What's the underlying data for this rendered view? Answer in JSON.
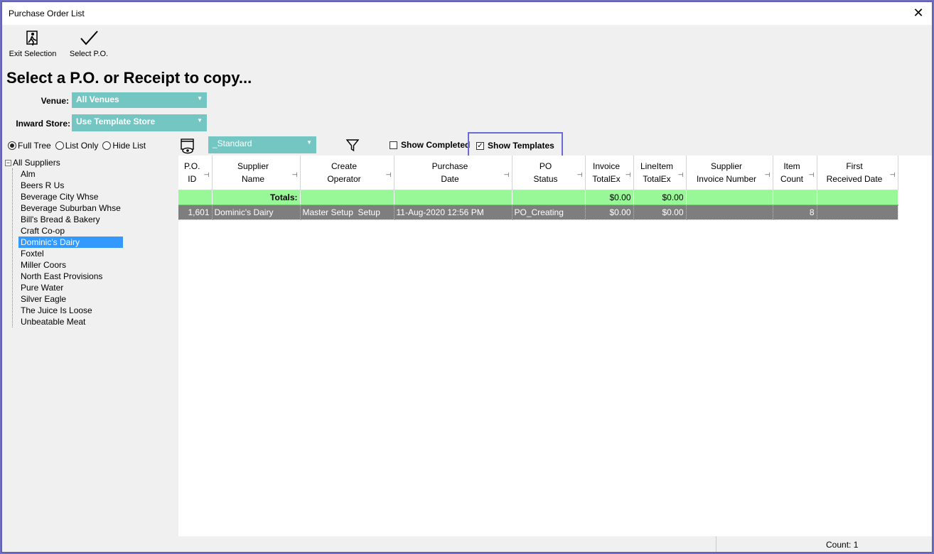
{
  "window": {
    "title": "Purchase Order List",
    "close_glyph": "✕"
  },
  "toolbar": {
    "exit_label": "Exit Selection",
    "select_label": "Select P.O."
  },
  "heading": "Select a P.O. or Receipt to copy...",
  "venue": {
    "label": "Venue:",
    "value": "All Venues"
  },
  "inward_store": {
    "label": "Inward Store:",
    "value": "Use Template Store"
  },
  "tree_mode": {
    "options": [
      "Full Tree",
      "List Only",
      "Hide List"
    ],
    "selected": "Full Tree"
  },
  "layout_combo": {
    "value": "_Standard"
  },
  "show_completed": {
    "label": "Show Completed",
    "checked": false
  },
  "show_templates": {
    "label": "Show Templates",
    "checked": true,
    "check_glyph": "✓"
  },
  "tree": {
    "root": "All Suppliers",
    "items": [
      "Alm",
      "Beers R Us",
      "Beverage City Whse",
      "Beverage Suburban Whse",
      "Bill's Bread & Bakery",
      "Craft Co-op",
      "Dominic's Dairy",
      "Foxtel",
      "Miller Coors",
      "North East Provisions",
      "Pure Water",
      "Silver Eagle",
      "The Juice Is Loose",
      "Unbeatable Meat"
    ],
    "selected": "Dominic's Dairy"
  },
  "grid": {
    "columns": [
      [
        "P.O.",
        "ID"
      ],
      [
        "Supplier",
        "Name"
      ],
      [
        "Create",
        "Operator"
      ],
      [
        "Purchase",
        "Date"
      ],
      [
        "PO",
        "Status"
      ],
      [
        "Invoice",
        "TotalEx"
      ],
      [
        "LineItem",
        "TotalEx"
      ],
      [
        "Supplier",
        "Invoice Number"
      ],
      [
        "Item",
        "Count"
      ],
      [
        "First",
        "Received Date"
      ]
    ],
    "totals_label": "Totals:",
    "totals": {
      "invoice_totalex": "$0.00",
      "lineitem_totalex": "$0.00"
    },
    "rows": [
      {
        "po_id": "1,601",
        "supplier": "Dominic's Dairy",
        "operator": "Master Setup  Setup",
        "date": "11-Aug-2020 12:56 PM",
        "status": "PO_Creating",
        "invoice_totalex": "$0.00",
        "lineitem_totalex": "$0.00",
        "invoice_number": "",
        "item_count": "8",
        "first_received": ""
      }
    ]
  },
  "status": {
    "count": "Count: 1"
  },
  "colors": {
    "accent": "#74c6c2",
    "totals_bg": "#98f898",
    "selected_row": "#7e7e7e",
    "highlight_box": "#6b6bd6",
    "tree_selection": "#3399ff"
  }
}
